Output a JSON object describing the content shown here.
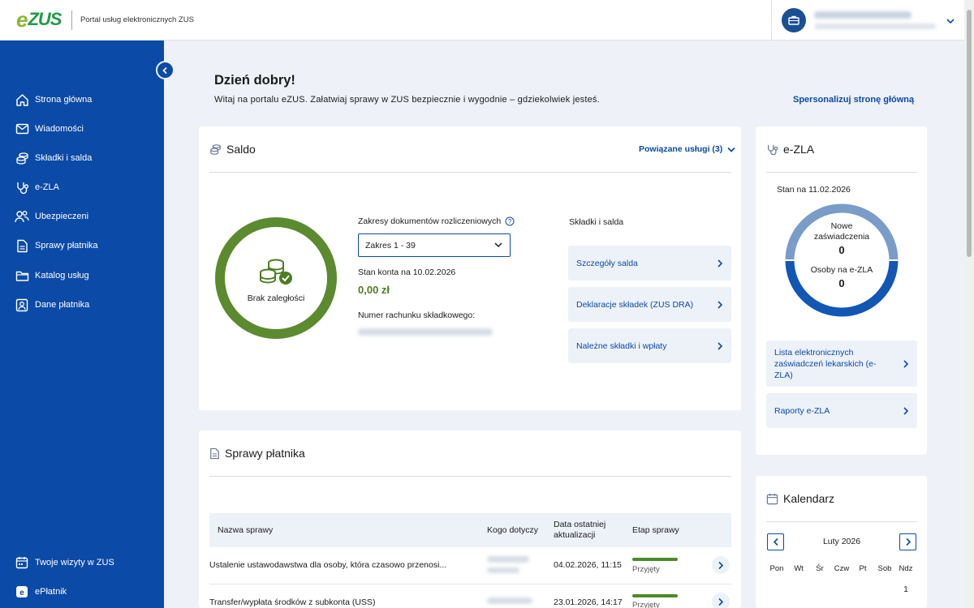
{
  "header": {
    "logo_e": "e",
    "logo_zus": "ZUS",
    "portal_title": "Portal usług elektronicznych ZUS"
  },
  "sidebar": {
    "items": [
      {
        "label": "Strona główna",
        "icon": "home-icon"
      },
      {
        "label": "Wiadomości",
        "icon": "mail-icon"
      },
      {
        "label": "Składki i salda",
        "icon": "coins-icon"
      },
      {
        "label": "e-ZLA",
        "icon": "stethoscope-icon"
      },
      {
        "label": "Ubezpieczeni",
        "icon": "people-icon"
      },
      {
        "label": "Sprawy płatnika",
        "icon": "document-icon"
      },
      {
        "label": "Katalog usług",
        "icon": "folder-icon"
      },
      {
        "label": "Dane płatnika",
        "icon": "id-card-icon"
      }
    ],
    "bottom_items": [
      {
        "label": "Twoje wizyty w ZUS",
        "icon": "calendar-icon"
      },
      {
        "label": "ePłatnik",
        "icon": "eplatnik-icon"
      }
    ]
  },
  "main": {
    "greeting": "Dzień dobry!",
    "welcome": "Witaj na portalu eZUS. Załatwiaj sprawy w ZUS bezpiecznie i wygodnie – gdziekolwiek jesteś.",
    "personalize_link": "Spersonalizuj stronę główną"
  },
  "saldo": {
    "title": "Saldo",
    "related_services": "Powiązane usługi (3)",
    "status_label": "Brak zaległości",
    "ranges_label": "Zakresy dokumentów rozliczeniowych",
    "range_selected": "Zakres 1 - 39",
    "account_state_label": "Stan konta na 10.02.2026",
    "account_value": "0,00 zł",
    "account_number_label": "Numer rachunku składkowego:",
    "actions_title": "Składki i salda",
    "actions": [
      "Szczegóły salda",
      "Deklaracje składek (ZUS DRA)",
      "Należne składki i wpłaty"
    ],
    "colors": {
      "ring": "#5b8a2f",
      "value": "#4b7d23"
    }
  },
  "ezla": {
    "title": "e-ZLA",
    "state_label": "Stan na 11.02.2026",
    "new_certs_label_1": "Nowe",
    "new_certs_label_2": "zaświadczenia",
    "new_certs_value": "0",
    "persons_label": "Osoby na e-ZLA",
    "persons_value": "0",
    "links": [
      "Lista elektronicznych zaświadczeń lekarskich (e-ZLA)",
      "Raporty e-ZLA"
    ],
    "colors": {
      "top": "#7a9cc8",
      "bottom": "#1257b3"
    }
  },
  "cases": {
    "title": "Sprawy płatnika",
    "columns": {
      "name": "Nazwa sprawy",
      "concerns": "Kogo dotyczy",
      "updated_1": "Data ostatniej",
      "updated_2": "aktualizacji",
      "stage": "Etap sprawy"
    },
    "rows": [
      {
        "name": "Ustalenie ustawodawstwa dla osoby, która czasowo przenosi...",
        "updated": "04.02.2026, 11:15",
        "stage": "Przyjęty"
      },
      {
        "name": "Transfer/wypłata środków z subkonta (USS)",
        "updated": "23.01.2026, 14:17",
        "stage": "Przyjęty"
      }
    ]
  },
  "calendar": {
    "title": "Kalendarz",
    "month": "Luty 2026",
    "days": [
      "Pon",
      "Wt",
      "Śr",
      "Czw",
      "Pt",
      "Sob",
      "Ndz"
    ],
    "first_day": "1"
  }
}
